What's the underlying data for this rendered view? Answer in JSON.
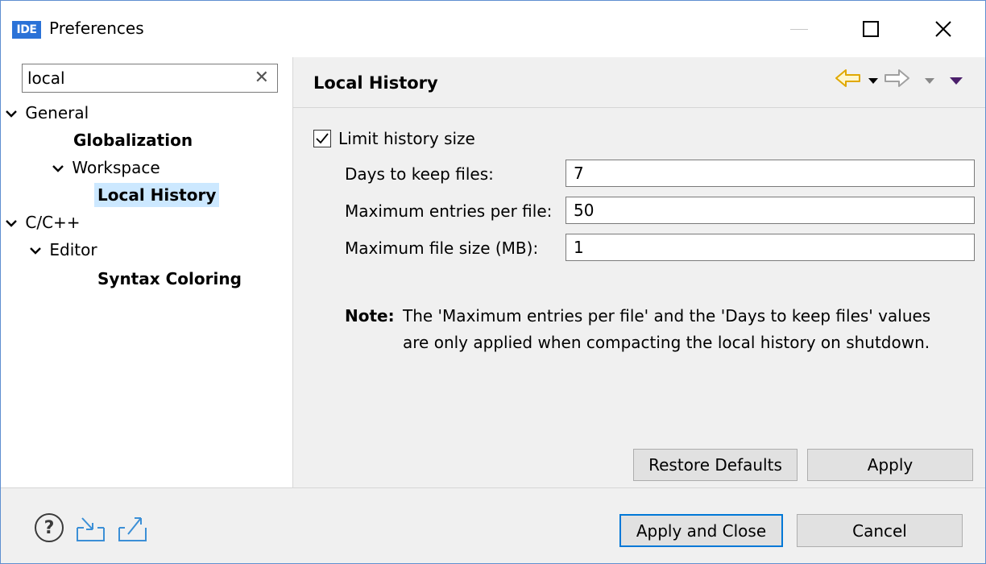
{
  "window": {
    "title": "Preferences",
    "logo_text": "IDE",
    "accent": "#2b72d7"
  },
  "filter": {
    "value": "local",
    "clear_glyph": "✕"
  },
  "tree": {
    "items": [
      {
        "label": "General",
        "expanded": true
      },
      {
        "label": "Globalization"
      },
      {
        "label": "Workspace",
        "expanded": true
      },
      {
        "label": "Local History",
        "selected": true
      },
      {
        "label": "C/C++",
        "expanded": true
      },
      {
        "label": "Editor",
        "expanded": true
      },
      {
        "label": "Syntax Coloring"
      }
    ],
    "selection_color": "#cce8ff"
  },
  "page": {
    "title": "Local History",
    "limit_checkbox": {
      "label": "Limit history size",
      "checked": true
    },
    "fields": [
      {
        "label": "Days to keep files:",
        "value": "7"
      },
      {
        "label": "Maximum entries per file:",
        "value": "50"
      },
      {
        "label": "Maximum file size (MB):",
        "value": "1"
      }
    ],
    "note": {
      "label": "Note:",
      "line1": "The 'Maximum entries per file' and the 'Days to keep files' values",
      "line2": "are only applied when compacting the local history on shutdown."
    },
    "restore_defaults": "Restore Defaults",
    "apply": "Apply"
  },
  "bottom": {
    "apply_and_close": "Apply and Close",
    "cancel": "Cancel",
    "help_glyph": "?"
  },
  "icons": {
    "back": "arrow-left-icon",
    "forward": "arrow-right-icon",
    "import": "import-icon",
    "export": "export-icon"
  },
  "colors": {
    "default_button_border": "#0078d7",
    "nav_back": "#e0a800"
  }
}
